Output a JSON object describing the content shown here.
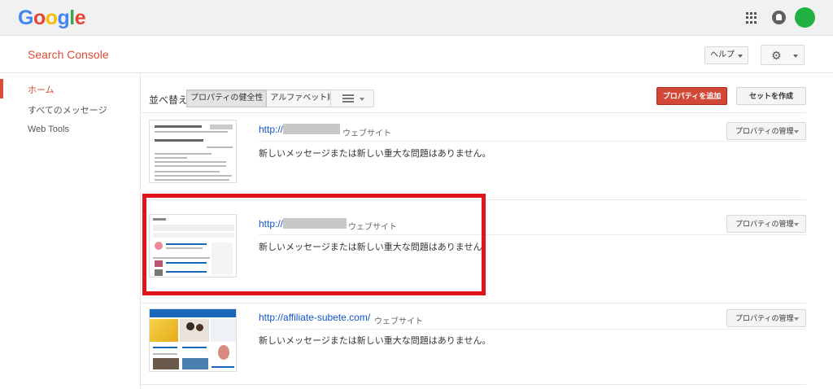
{
  "topbar": {
    "logo_letters": [
      {
        "ch": "G",
        "color": "#4285f4"
      },
      {
        "ch": "o",
        "color": "#ea4335"
      },
      {
        "ch": "o",
        "color": "#fbbc05"
      },
      {
        "ch": "g",
        "color": "#4285f4"
      },
      {
        "ch": "l",
        "color": "#34a853"
      },
      {
        "ch": "e",
        "color": "#ea4335"
      }
    ],
    "icons": [
      "apps-icon",
      "notifications-icon"
    ],
    "avatar_color": "#1fb141"
  },
  "header": {
    "product_title": "Search Console",
    "help_label": "ヘルプ",
    "settings_icon": "gear-icon"
  },
  "sidebar": {
    "items": [
      {
        "label": "ホーム",
        "active": true
      },
      {
        "label": "すべてのメッセージ",
        "active": false
      },
      {
        "label": "Web Tools",
        "active": false
      }
    ]
  },
  "toolbar": {
    "sort_label": "並べ替え:",
    "sort_options": [
      {
        "label": "プロパティの健全性",
        "active": true
      },
      {
        "label": "アルファベット順",
        "active": false
      }
    ],
    "view_icon": "list-icon",
    "add_property_label": "プロパティを追加",
    "create_set_label": "セットを作成"
  },
  "properties": [
    {
      "url_prefix": "http://",
      "url_redacted": true,
      "type": "ウェブサイト",
      "message": "新しいメッセージまたは新しい重大な問題はありません。",
      "manage_label": "プロパティの管理"
    },
    {
      "url_prefix": "http://",
      "url_redacted": true,
      "type": "ウェブサイト",
      "message": "新しいメッセージまたは新しい重大な問題はありません。",
      "manage_label": "プロパティの管理"
    },
    {
      "url_prefix": "http://affiliate-subete.com/",
      "url_redacted": false,
      "type": "ウェブサイト",
      "message": "新しいメッセージまたは新しい重大な問題はありません。",
      "manage_label": "プロパティの管理"
    }
  ],
  "colors": {
    "accent": "#dd4b39",
    "link": "#1155cc",
    "highlight_box": "#e1141e",
    "add_button": "#d14836"
  }
}
